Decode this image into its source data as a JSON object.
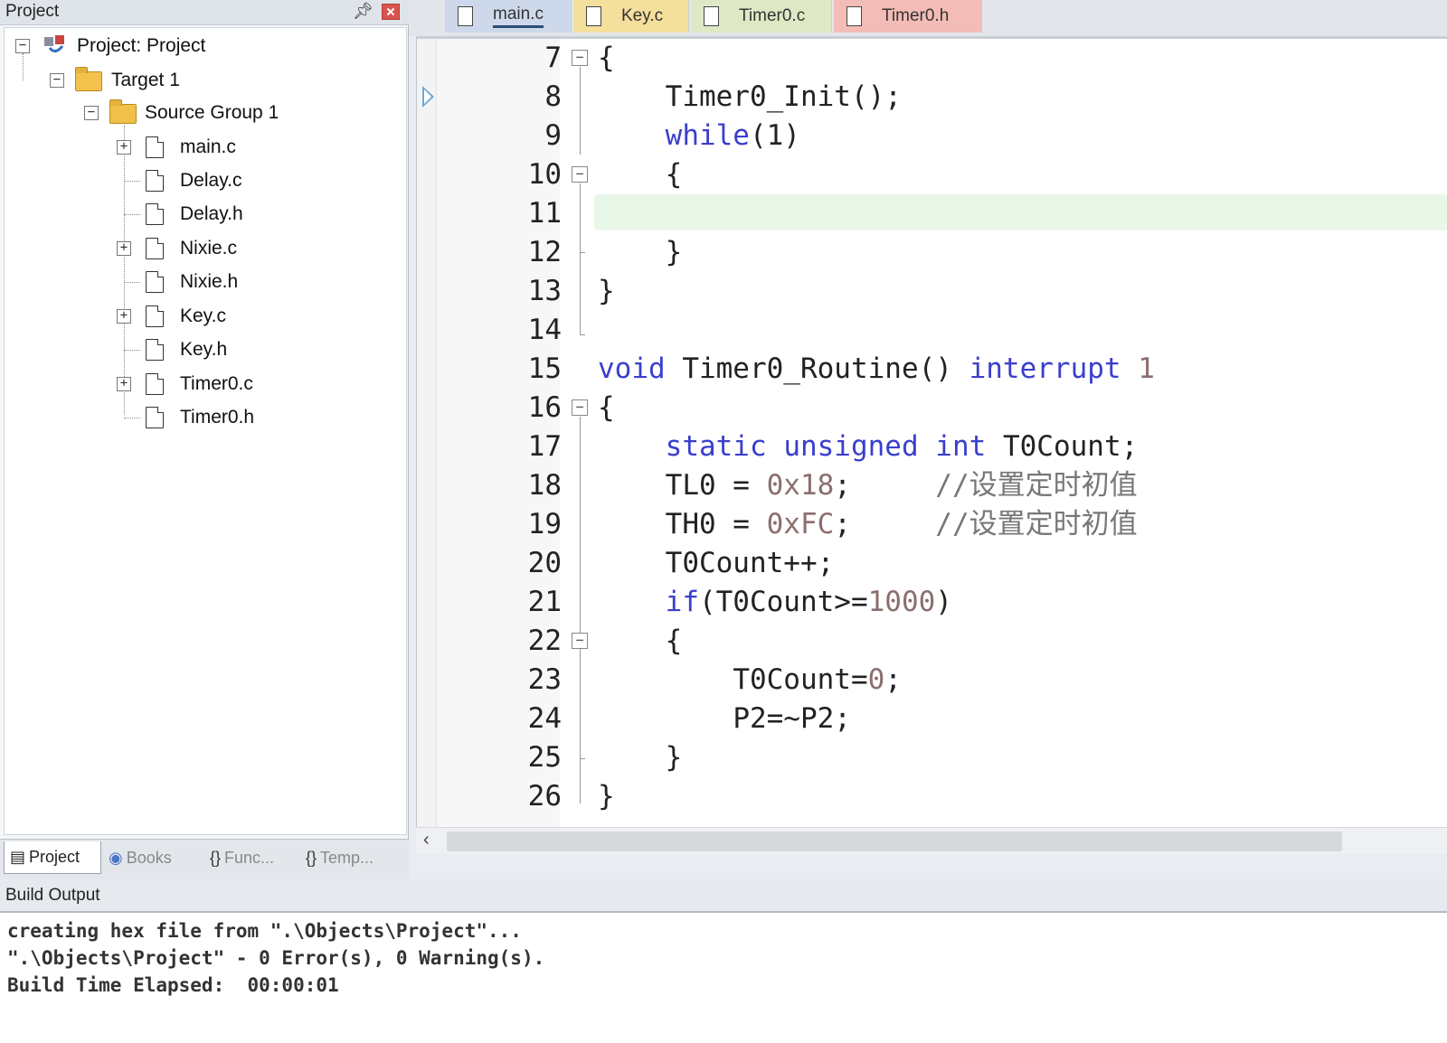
{
  "project_panel": {
    "title": "Project",
    "tree": {
      "project_label": "Project: Project",
      "target_label": "Target 1",
      "group_label": "Source Group 1",
      "files": [
        {
          "name": "main.c",
          "expandable": true
        },
        {
          "name": "Delay.c",
          "expandable": false
        },
        {
          "name": "Delay.h",
          "expandable": false
        },
        {
          "name": "Nixie.c",
          "expandable": true
        },
        {
          "name": "Nixie.h",
          "expandable": false
        },
        {
          "name": "Key.c",
          "expandable": true
        },
        {
          "name": "Key.h",
          "expandable": false
        },
        {
          "name": "Timer0.c",
          "expandable": true
        },
        {
          "name": "Timer0.h",
          "expandable": false
        }
      ]
    },
    "tabs": [
      "Project",
      "Books",
      "Func...",
      "Temp..."
    ]
  },
  "editor": {
    "tabs": [
      {
        "label": "main.c",
        "color": "#cdd9ea",
        "active": true
      },
      {
        "label": "Key.c",
        "color": "#f5df9c",
        "active": false
      },
      {
        "label": "Timer0.c",
        "color": "#dfe8c4",
        "active": false
      },
      {
        "label": "Timer0.h",
        "color": "#f3bcb6",
        "active": false
      }
    ],
    "line_numbers": [
      "7",
      "8",
      "9",
      "10",
      "11",
      "12",
      "13",
      "14",
      "15",
      "16",
      "17",
      "18",
      "19",
      "20",
      "21",
      "22",
      "23",
      "24",
      "25",
      "26"
    ],
    "code": {
      "l7": "{",
      "l8": "    Timer0_Init();",
      "l9_kw": "while",
      "l9_rest": "(1)",
      "l10": "    {",
      "l12": "    }",
      "l13": "}",
      "l15_kw": "void",
      "l15_mid": " Timer0_Routine() ",
      "l15_kw2": "interrupt",
      "l15_num": " 1",
      "l16": "{",
      "l17_kw1": "static",
      "l17_kw2": "unsigned",
      "l17_kw3": "int",
      "l17_rest": " T0Count;",
      "l18_code": "TL0 = ",
      "l18_num": "0x18",
      "l18_end": ";",
      "l18_cm": "//设置定时初值",
      "l19_code": "TH0 = ",
      "l19_num": "0xFC",
      "l19_end": ";",
      "l19_cm": "//设置定时初值",
      "l20": "T0Count++;",
      "l21_kw": "if",
      "l21_rest1": "(T0Count>=",
      "l21_num": "1000",
      "l21_rest2": ")",
      "l22": "{",
      "l23_code": "T0Count=",
      "l23_num": "0",
      "l23_end": ";",
      "l24": "P2=~P2;",
      "l25": "}",
      "l26": "}"
    }
  },
  "build_output": {
    "title": "Build Output",
    "lines": [
      "creating hex file from \".\\Objects\\Project\"...",
      "\".\\Objects\\Project\" - 0 Error(s), 0 Warning(s).",
      "Build Time Elapsed:  00:00:01"
    ]
  }
}
